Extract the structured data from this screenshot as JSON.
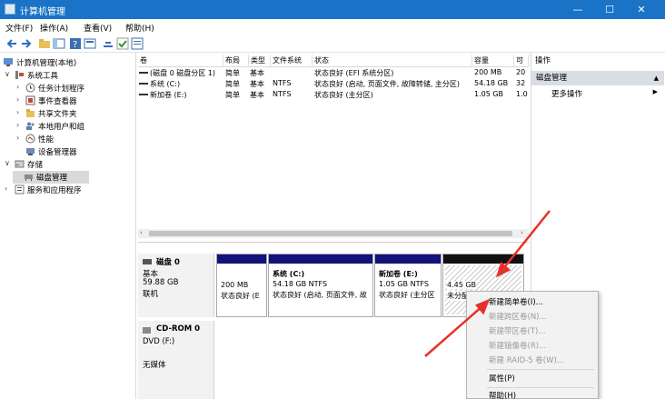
{
  "window": {
    "title": "计算机管理",
    "minimize": "—",
    "maximize": "☐",
    "close": "✕"
  },
  "menu": [
    "文件(F)",
    "操作(A)",
    "查看(V)",
    "帮助(H)"
  ],
  "tree": {
    "root": "计算机管理(本地)",
    "system_tools": "系统工具",
    "task_scheduler": "任务计划程序",
    "event_viewer": "事件查看器",
    "shared_folders": "共享文件夹",
    "local_users": "本地用户和组",
    "performance": "性能",
    "device_manager": "设备管理器",
    "storage": "存储",
    "disk_management": "磁盘管理",
    "services_apps": "服务和应用程序"
  },
  "volumes": {
    "headers": [
      "卷",
      "布局",
      "类型",
      "文件系统",
      "状态",
      "容量",
      "可"
    ],
    "rows": [
      [
        "(磁盘 0 磁盘分区 1)",
        "简单",
        "基本",
        "",
        "状态良好 (EFI 系统分区)",
        "200 MB",
        "20"
      ],
      [
        "系统 (C:)",
        "简单",
        "基本",
        "NTFS",
        "状态良好 (启动, 页面文件, 故障转储, 主分区)",
        "54.18 GB",
        "32"
      ],
      [
        "新加卷 (E:)",
        "简单",
        "基本",
        "NTFS",
        "状态良好 (主分区)",
        "1.05 GB",
        "1.0"
      ]
    ]
  },
  "disks": {
    "disk0": {
      "name": "磁盘 0",
      "type": "基本",
      "size": "59.88 GB",
      "status": "联机",
      "partitions": [
        {
          "size": "200 MB",
          "status": "状态良好 (E"
        },
        {
          "name": "系统 (C:)",
          "size": "54.18 GB NTFS",
          "status": "状态良好 (启动, 页面文件, 故"
        },
        {
          "name": "新加卷 (E:)",
          "size": "1.05 GB NTFS",
          "status": "状态良好 (主分区"
        },
        {
          "size": "4.45 GB",
          "status": "未分配"
        }
      ]
    },
    "cdrom0": {
      "name": "CD-ROM 0",
      "drive": "DVD (F:)",
      "media": "无媒体"
    }
  },
  "actions": {
    "header": "操作",
    "section": "磁盘管理",
    "more": "更多操作"
  },
  "context_menu": {
    "items": [
      {
        "label": "新建简单卷(I)...",
        "enabled": true
      },
      {
        "label": "新建跨区卷(N)...",
        "enabled": false
      },
      {
        "label": "新建带区卷(T)...",
        "enabled": false
      },
      {
        "label": "新建镜像卷(R)...",
        "enabled": false
      },
      {
        "label": "新建 RAID-5 卷(W)...",
        "enabled": false
      },
      {
        "label": "属性(P)",
        "enabled": true
      },
      {
        "label": "帮助(H)",
        "enabled": true
      }
    ]
  },
  "colors": {
    "titlebar": "#1a73c6",
    "partition_bar": "#12127a",
    "annotation_arrow": "#e8302a"
  }
}
